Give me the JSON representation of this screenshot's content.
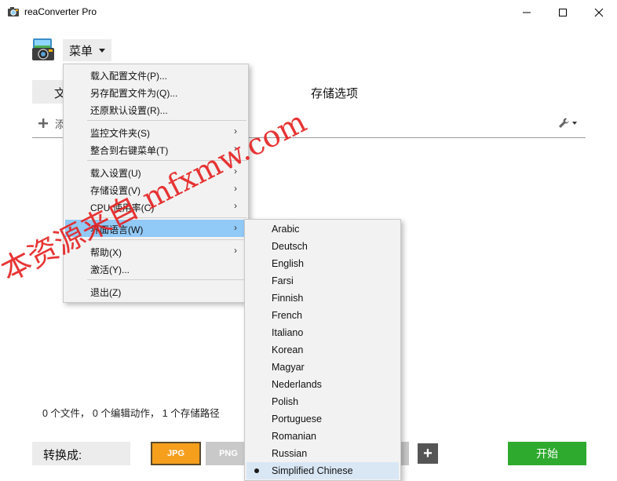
{
  "window": {
    "title": "reaConverter Pro"
  },
  "toolbar": {
    "menu_label": "菜单"
  },
  "tabs": {
    "files_label": "文",
    "storage_label": "存储选项"
  },
  "add_row": {
    "label": "添"
  },
  "context_menu": {
    "items": [
      {
        "label": "载入配置文件(P)...",
        "submenu": false
      },
      {
        "label": "另存配置文件为(Q)...",
        "submenu": false
      },
      {
        "label": "还原默认设置(R)...",
        "submenu": false
      },
      {
        "label": "监控文件夹(S)",
        "submenu": true
      },
      {
        "label": "整合到右键菜单(T)",
        "submenu": true
      },
      {
        "label": "载入设置(U)",
        "submenu": true
      },
      {
        "label": "存储设置(V)",
        "submenu": true
      },
      {
        "label": "CPU 使用率(C)",
        "submenu": true
      },
      {
        "label": "界面语言(W)",
        "submenu": true,
        "highlighted": true
      },
      {
        "label": "帮助(X)",
        "submenu": true
      },
      {
        "label": "激活(Y)...",
        "submenu": false
      },
      {
        "label": "退出(Z)",
        "submenu": false
      }
    ]
  },
  "language_menu": {
    "items": [
      {
        "label": "Arabic"
      },
      {
        "label": "Deutsch"
      },
      {
        "label": "English"
      },
      {
        "label": "Farsi"
      },
      {
        "label": "Finnish"
      },
      {
        "label": "French"
      },
      {
        "label": "Italiano"
      },
      {
        "label": "Korean"
      },
      {
        "label": "Magyar"
      },
      {
        "label": "Nederlands"
      },
      {
        "label": "Polish"
      },
      {
        "label": "Portuguese"
      },
      {
        "label": "Romanian"
      },
      {
        "label": "Russian"
      },
      {
        "label": "Simplified Chinese",
        "selected": true
      }
    ]
  },
  "status": {
    "text": "0 个文件， 0 个编辑动作， 1 个存储路径"
  },
  "bottom": {
    "convert_label": "转换成:",
    "formats": [
      "JPG",
      "PNG"
    ],
    "add_format_label": "+",
    "start_label": "开始"
  },
  "watermark": {
    "text": "本资源来自 mfxmw.com"
  },
  "colors": {
    "accent_start": "#2eaa2e",
    "format_active": "#f59f1d",
    "menu_highlight": "#91c9f7",
    "watermark": "#e62424"
  },
  "icons": {
    "app": "camera-icon",
    "minimize": "minimize-icon",
    "maximize": "maximize-icon",
    "close": "close-icon",
    "add": "plus-icon",
    "settings": "wrench-icon"
  }
}
